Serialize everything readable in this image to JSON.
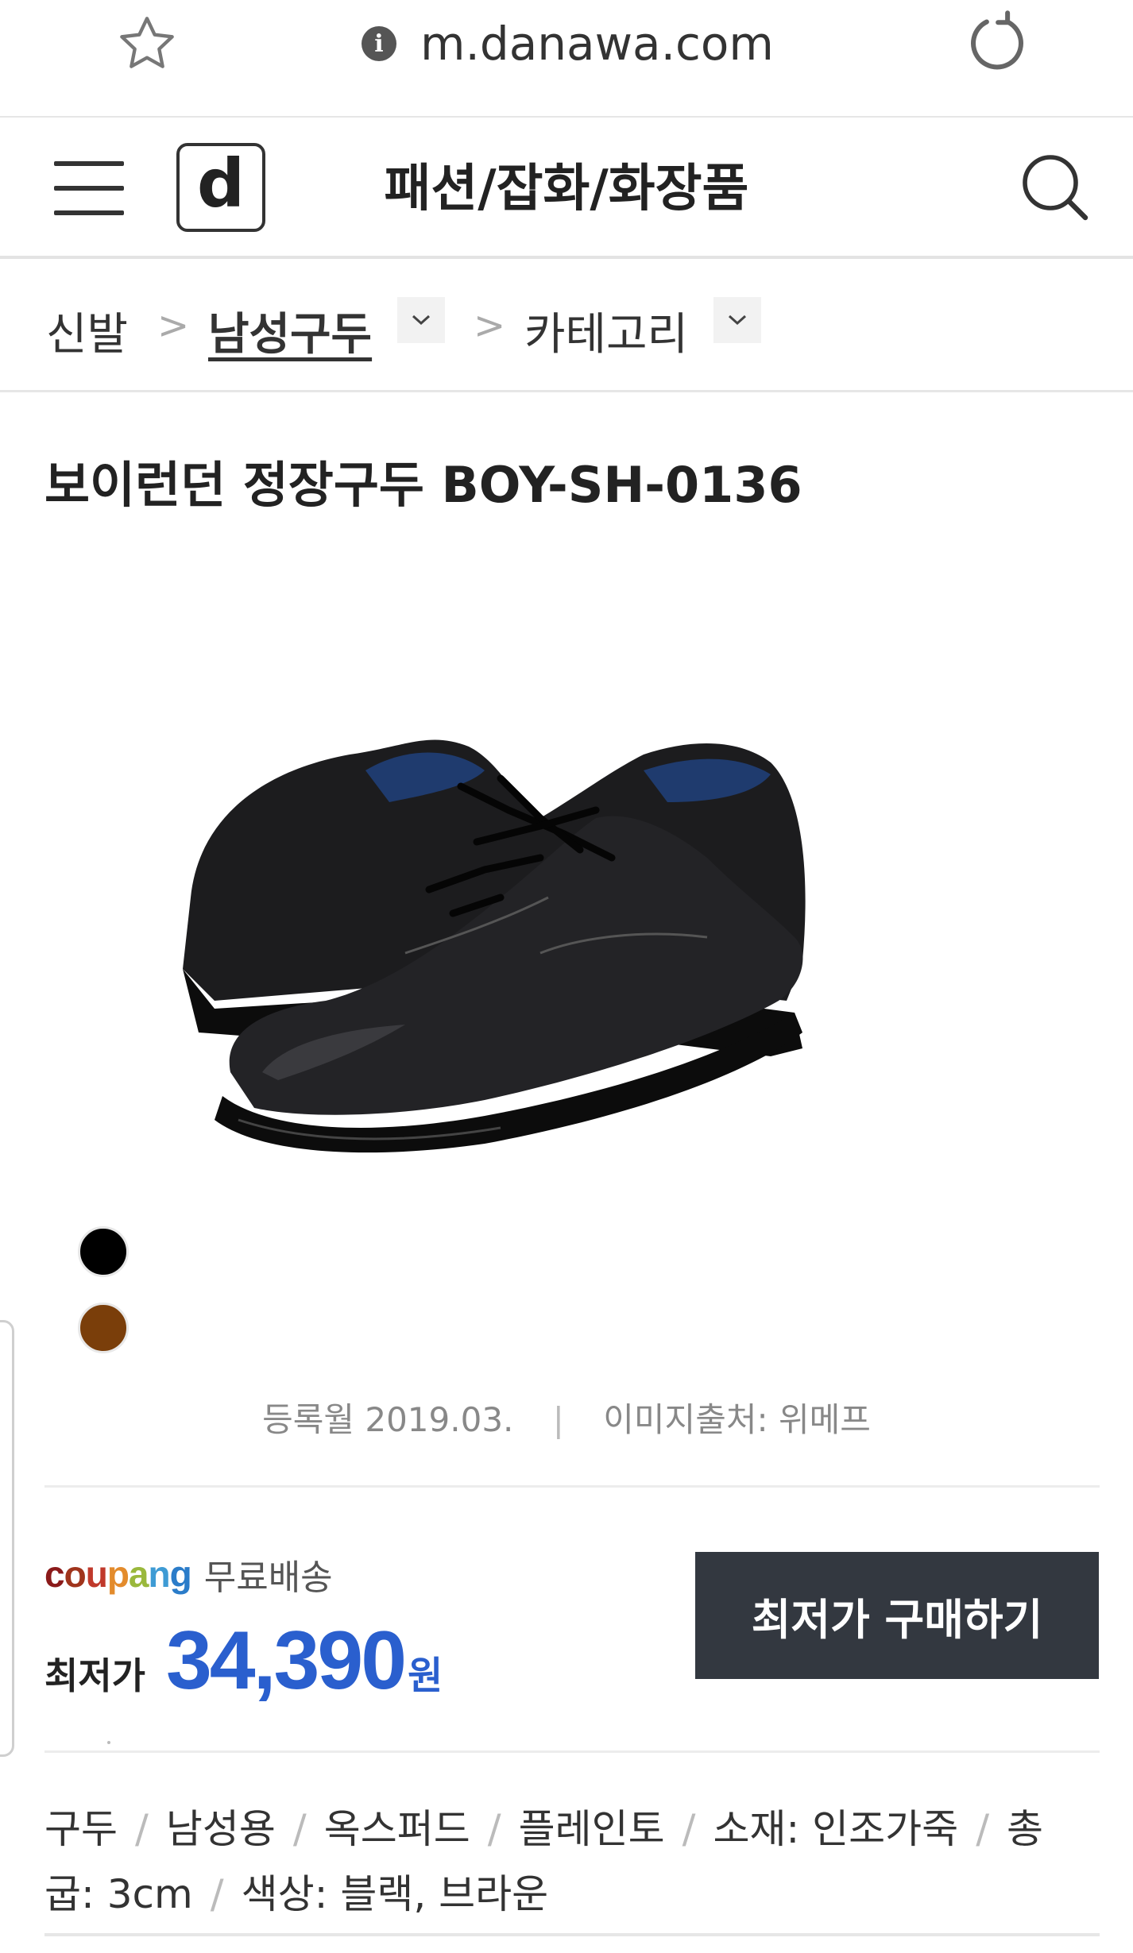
{
  "browser": {
    "url": "m.danawa.com",
    "info_icon": "i"
  },
  "header": {
    "logo": "d",
    "title": "패션/잡화/화장품"
  },
  "breadcrumb": {
    "items": [
      "신발",
      "남성구두",
      "카테고리"
    ],
    "separator": ">"
  },
  "product": {
    "title": "보이런던 정장구두 BOY-SH-0136",
    "colors": [
      "#000000",
      "#7a3e0a"
    ],
    "registered": "등록월 2019.03.",
    "image_source": "이미지출처: 위메프"
  },
  "price": {
    "mall_logo": "coupang",
    "shipping": "무료배송",
    "lowest_label": "최저가",
    "amount": "34,390",
    "unit": "원",
    "buy_label": "최저가 구매하기"
  },
  "specs": {
    "items": [
      "구두",
      "남성용",
      "옥스퍼드",
      "플레인토",
      "소재: 인조가죽",
      "총",
      "굽: 3cm",
      "색상: 블랙, 브라운"
    ]
  },
  "colors": {
    "price_blue": "#2a5fce",
    "button_dark": "#333840"
  }
}
